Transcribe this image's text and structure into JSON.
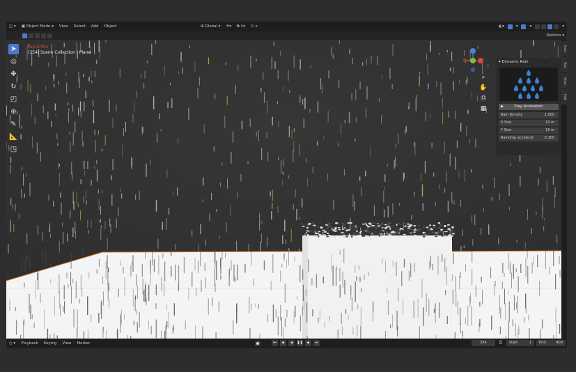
{
  "header": {
    "editor_icon": "viewport-icon",
    "mode": "Object Mode",
    "menus": [
      "View",
      "Select",
      "Add",
      "Object"
    ],
    "orientation": "Global",
    "options": "Options"
  },
  "viewport": {
    "info_line1": "Top Ortho",
    "info_line2": "(354) Scene Collection | Plane"
  },
  "panel": {
    "title": "Dynamic Rain",
    "play_button": "Play Animation",
    "properties": [
      {
        "label": "Rain Density",
        "value": "1.000"
      },
      {
        "label": "X Size",
        "value": "10 m"
      },
      {
        "label": "Y Size",
        "value": "10 m"
      },
      {
        "label": "Raindrop accelerat",
        "value": "0.300"
      }
    ],
    "tabs": [
      "Item",
      "Tool",
      "View",
      "Edit"
    ]
  },
  "timeline": {
    "menus": [
      "Playback",
      "Keying",
      "View",
      "Marker"
    ],
    "current_frame": "354",
    "start_label": "Start",
    "start_value": "1",
    "end_label": "End",
    "end_value": "400"
  },
  "colors": {
    "accent": "#4a7bd0",
    "floor": "#f4f5f7",
    "rain": "#c8c8c8",
    "rain_yellow": "#b7c24a",
    "selection_outline": "#e0781e"
  }
}
